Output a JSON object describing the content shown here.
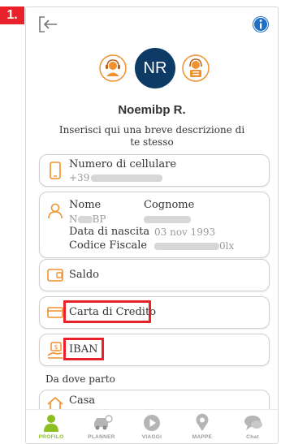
{
  "step": {
    "label": "1."
  },
  "header": {
    "logout_icon": "logout-icon",
    "info_icon": "info-icon"
  },
  "profile": {
    "initials": "NR",
    "name": "Noemibp R.",
    "bio_placeholder": "Inserisci qui una breve descrizione di te stesso"
  },
  "phone_card": {
    "label": "Numero di cellulare",
    "value": "+39"
  },
  "personal_card": {
    "first_name_label": "Nome",
    "first_name_value": "N",
    "first_name_tail": "BP",
    "last_name_label": "Cognome",
    "birth_label": "Data di nascita",
    "birth_value": "03 nov 1993",
    "fiscal_label": "Codice Fiscale",
    "fiscal_tail": "0lx"
  },
  "menu": {
    "saldo": "Saldo",
    "credit_card": "Carta di Credito",
    "iban": "IBAN"
  },
  "section": {
    "from_title": "Da dove parto"
  },
  "home_card": {
    "label": "Casa"
  },
  "tabs": [
    {
      "label": "PROFILO",
      "active": true
    },
    {
      "label": "PLANNER",
      "active": false
    },
    {
      "label": "VIAGGI",
      "active": false
    },
    {
      "label": "MAPPE",
      "active": false
    },
    {
      "label": "Chat",
      "active": false
    }
  ],
  "colors": {
    "accent_orange": "#f0912d",
    "avatar_navy": "#0e3a66",
    "info_blue": "#1f6fc5",
    "active_green": "#8bbf22",
    "highlight_red": "#e8212a"
  }
}
